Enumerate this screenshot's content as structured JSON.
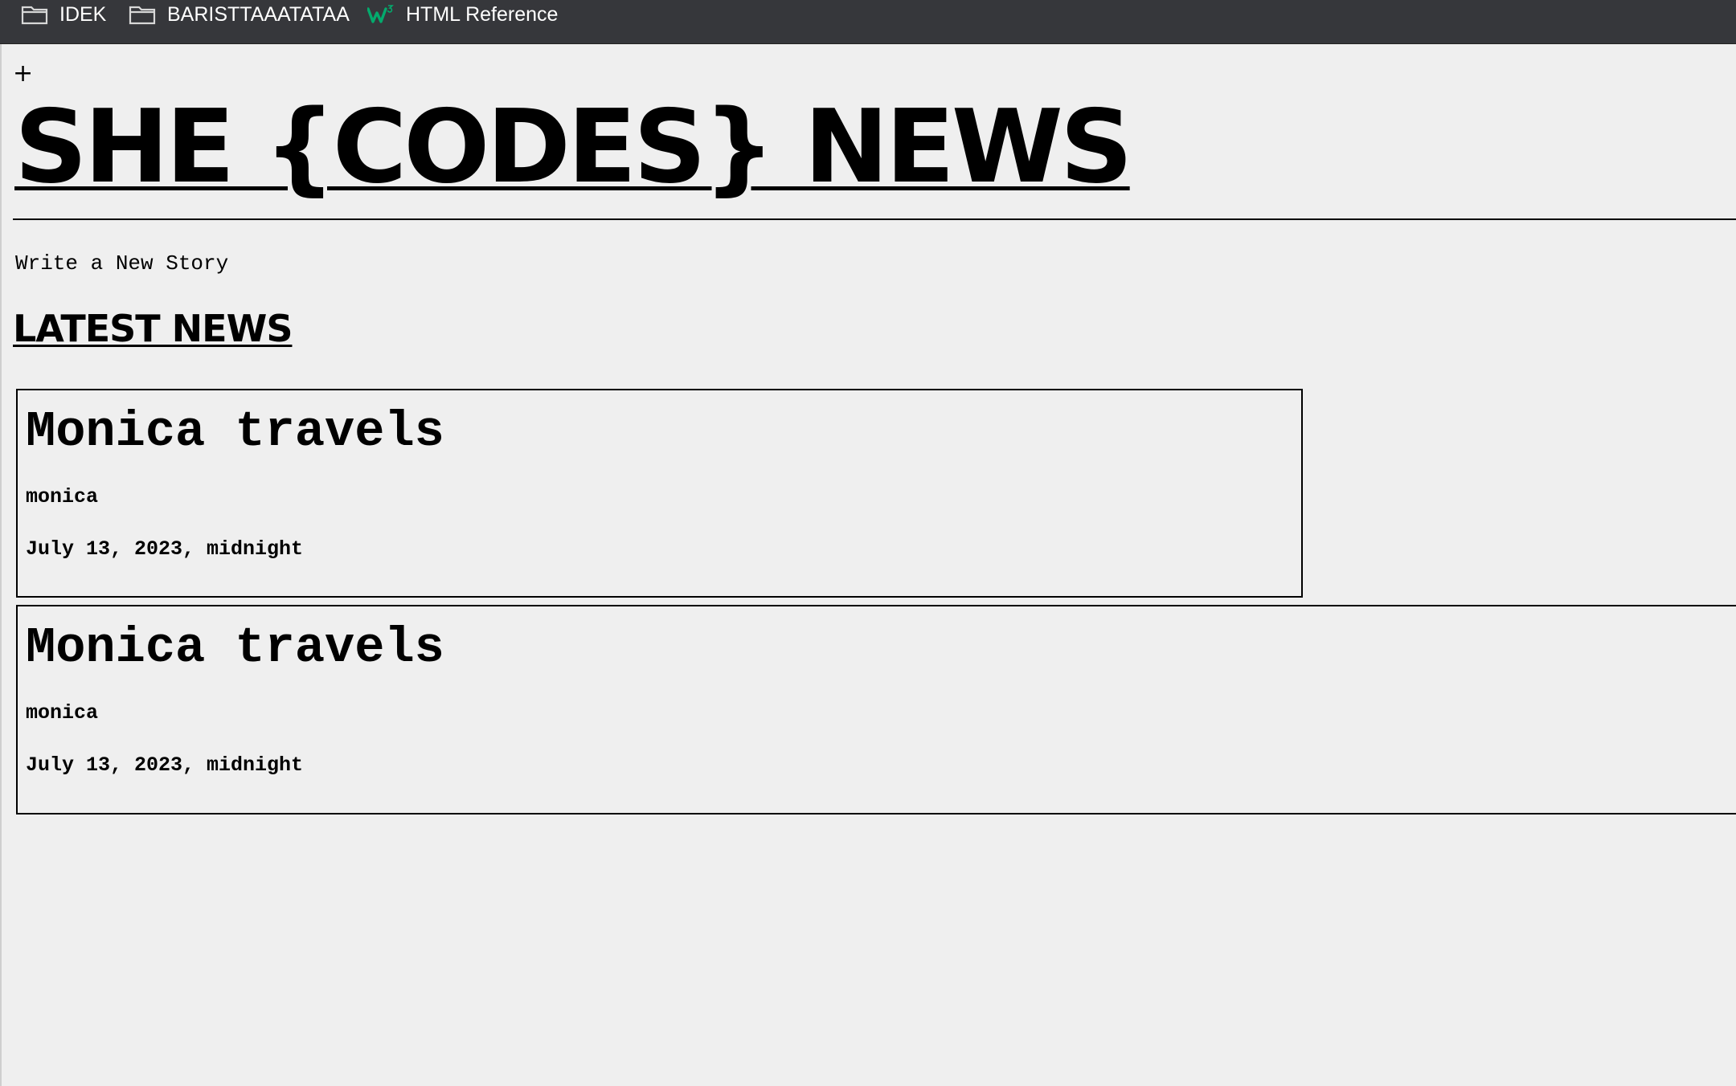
{
  "bookmarks": [
    {
      "label": "IDEK",
      "icon": "folder-icon"
    },
    {
      "label": "BARISTTAAATATAA",
      "icon": "folder-icon"
    },
    {
      "label": "HTML Reference",
      "icon": "w3schools-icon"
    }
  ],
  "header": {
    "plus_label": "+",
    "site_title": "SHE {CODES} NEWS",
    "new_story_label": "Write a New Story"
  },
  "main": {
    "section_heading": "LATEST NEWS",
    "stories": [
      {
        "title": "Monica travels",
        "author": "monica",
        "date": "July 13, 2023, midnight"
      },
      {
        "title": "Monica travels",
        "author": "monica",
        "date": "July 13, 2023, midnight"
      }
    ]
  },
  "colors": {
    "bookmarks_bar": "#36373b",
    "page_background": "#efefef",
    "w3_green": "#04aa6d"
  }
}
